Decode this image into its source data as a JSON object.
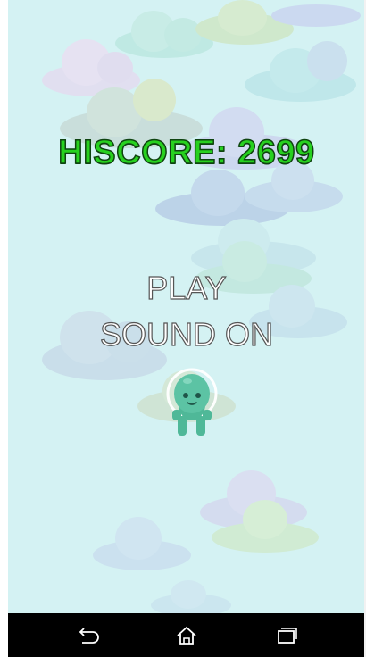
{
  "game": {
    "hiscore_text": "HISCORE: 2699",
    "menu": {
      "play_label": "PLAY",
      "sound_label": "SOUND ON"
    }
  },
  "colors": {
    "sky_background": "#d4f2f3",
    "hiscore_fill": "#27d11f",
    "hiscore_outline": "#0f4410",
    "menu_text_fill": "#ffffff",
    "menu_text_outline": "#555555",
    "character_body": "#4fb898",
    "character_ring": "#ffffff",
    "navbar_background": "#000000",
    "navbar_icon": "#ffffff"
  },
  "icons": {
    "character": "green-blob-creature",
    "back": "back-arrow-icon",
    "home": "home-icon",
    "recents": "recent-apps-icon"
  }
}
